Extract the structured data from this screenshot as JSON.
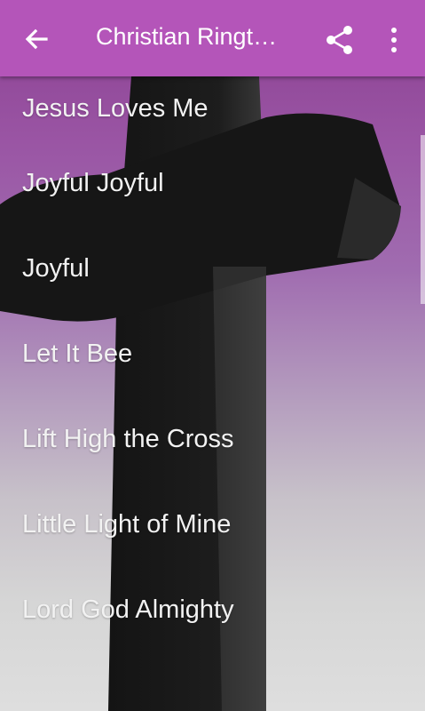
{
  "appbar": {
    "title": "Christian Ringt…",
    "back_icon": "arrow-back-icon",
    "share_icon": "share-icon",
    "menu_icon": "more-vert-icon",
    "color": "#b455b9"
  },
  "songs": [
    "Jesus Loves Me",
    "Joyful Joyful",
    "Joyful",
    "Let It Bee",
    "Lift High the Cross",
    "Little Light of Mine",
    "Lord God Almighty"
  ]
}
